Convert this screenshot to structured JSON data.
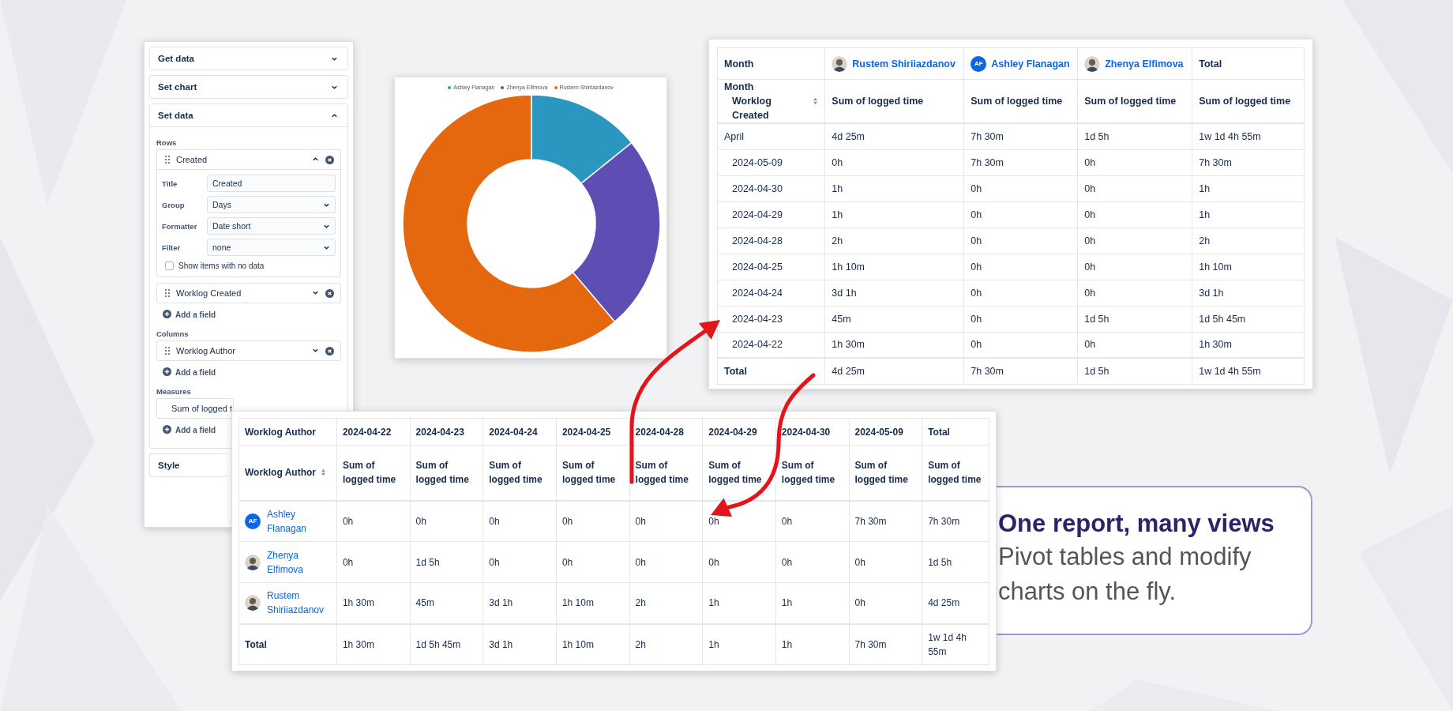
{
  "config_panel": {
    "sections": [
      {
        "title": "Get data",
        "expanded": false
      },
      {
        "title": "Set chart",
        "expanded": false
      },
      {
        "title": "Set data",
        "expanded": true
      }
    ],
    "groups": [
      {
        "label": "Rows",
        "fields": [
          {
            "label": "Created",
            "expanded": true,
            "settings": [
              {
                "label": "Title",
                "kind": "text",
                "value": "Created"
              },
              {
                "label": "Group",
                "kind": "select",
                "value": "Days"
              },
              {
                "label": "Formatter",
                "kind": "select",
                "value": "Date short"
              },
              {
                "label": "Filter",
                "kind": "select",
                "value": "none"
              }
            ],
            "checkbox": {
              "label": "Show items with no data",
              "checked": false
            }
          },
          {
            "label": "Worklog Created",
            "expanded": false
          }
        ],
        "add": "Add a field"
      },
      {
        "label": "Columns",
        "fields": [
          {
            "label": "Worklog Author",
            "expanded": false
          }
        ],
        "add": "Add a field"
      },
      {
        "label": "Measures",
        "fields": [
          {
            "label": "Sum of logged t"
          }
        ],
        "add": "Add a field"
      }
    ],
    "style_section": {
      "title": "Style"
    }
  },
  "donut_card": {
    "slices": [
      {
        "color": "#2a97c0"
      },
      {
        "color": "#5e4db2"
      },
      {
        "color": "#e5680f"
      }
    ],
    "chart_data": {
      "type": "donut",
      "categories": [
        "Ashley Flanagan",
        "Zhenya Elfimova",
        "Rustem Shiriiazdanov"
      ],
      "values": [
        14.2,
        24.6,
        61.2
      ]
    }
  },
  "month_table": {
    "header": [
      {
        "text": "Month",
        "kind": "plain"
      },
      {
        "text": "Rustem Shiriiazdanov",
        "kind": "photo"
      },
      {
        "text": "Ashley Flanagan",
        "kind": "initials",
        "initials": "AF"
      },
      {
        "text": "Zhenya Elfimova",
        "kind": "photo"
      },
      {
        "text": "Total",
        "kind": "plain"
      }
    ],
    "corner": [
      "Month",
      "Worklog Created"
    ],
    "subheader": [
      "Sum of logged time",
      "Sum of logged time",
      "Sum of logged time",
      "Sum of logged time"
    ],
    "rows": [
      {
        "label": "April",
        "values": [
          "4d 25m",
          "7h 30m",
          "1d 5h",
          "1w 1d 4h 55m"
        ],
        "children": [
          {
            "label": "2024-05-09",
            "values": [
              "0h",
              "7h 30m",
              "0h",
              "7h 30m"
            ]
          },
          {
            "label": "2024-04-30",
            "values": [
              "1h",
              "0h",
              "0h",
              "1h"
            ]
          },
          {
            "label": "2024-04-29",
            "values": [
              "1h",
              "0h",
              "0h",
              "1h"
            ]
          },
          {
            "label": "2024-04-28",
            "values": [
              "2h",
              "0h",
              "0h",
              "2h"
            ]
          },
          {
            "label": "2024-04-25",
            "values": [
              "1h 10m",
              "0h",
              "0h",
              "1h 10m"
            ]
          },
          {
            "label": "2024-04-24",
            "values": [
              "3d 1h",
              "0h",
              "0h",
              "3d 1h"
            ]
          },
          {
            "label": "2024-04-23",
            "values": [
              "45m",
              "0h",
              "1d 5h",
              "1d 5h 45m"
            ]
          },
          {
            "label": "2024-04-22",
            "values": [
              "1h 30m",
              "0h",
              "0h",
              "1h 30m"
            ]
          }
        ]
      }
    ],
    "total": {
      "label": "Total",
      "values": [
        "4d 25m",
        "7h 30m",
        "1d 5h",
        "1w 1d 4h 55m"
      ]
    }
  },
  "author_table": {
    "header": [
      "Worklog Author",
      "2024-04-22",
      "2024-04-23",
      "2024-04-24",
      "2024-04-25",
      "2024-04-28",
      "2024-04-29",
      "2024-04-30",
      "2024-05-09",
      "Total"
    ],
    "corner": "Worklog Author",
    "subheader": [
      "Sum of logged time",
      "Sum of logged time",
      "Sum of logged time",
      "Sum of logged time",
      "Sum of logged time",
      "Sum of logged time",
      "Sum of logged time",
      "Sum of logged time",
      "Sum of logged time"
    ],
    "rows": [
      {
        "name": "Ashley Flanagan",
        "kind": "initials",
        "initials": "AF",
        "values": [
          "0h",
          "0h",
          "0h",
          "0h",
          "0h",
          "0h",
          "0h",
          "7h 30m",
          "7h 30m"
        ]
      },
      {
        "name": "Zhenya Elfimova",
        "kind": "photo",
        "values": [
          "0h",
          "1d 5h",
          "0h",
          "0h",
          "0h",
          "0h",
          "0h",
          "0h",
          "1d 5h"
        ]
      },
      {
        "name": "Rustem Shiriiazdanov",
        "kind": "photo",
        "values": [
          "1h 30m",
          "45m",
          "3d 1h",
          "1h 10m",
          "2h",
          "1h",
          "1h",
          "0h",
          "4d 25m"
        ]
      }
    ],
    "total": {
      "label": "Total",
      "values": [
        "1h 30m",
        "1d 5h 45m",
        "3d 1h",
        "1h 10m",
        "2h",
        "1h",
        "1h",
        "7h 30m",
        "1w 1d 4h 55m"
      ]
    }
  },
  "callout": {
    "title": "One report, many views",
    "text": "Pivot tables and modify charts on the fly."
  }
}
